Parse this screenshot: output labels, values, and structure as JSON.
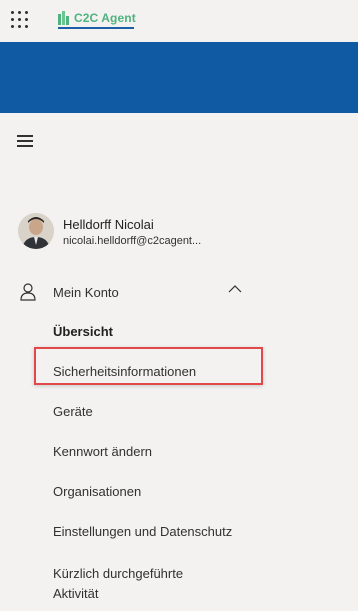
{
  "header": {
    "app_launcher_icon": "waffle-icon",
    "logo_text": "C2C Agent",
    "accent_color": "#4fb37f",
    "banner_color": "#0f5aa3"
  },
  "menu_icon": "hamburger-icon",
  "user": {
    "name": "Helldorff Nicolai",
    "email": "nicolai.helldorff@c2cagent..."
  },
  "nav": {
    "section_label": "Mein Konto",
    "section_icon": "person-icon",
    "section_expanded": true,
    "items": [
      {
        "label": "Übersicht",
        "active": true
      },
      {
        "label": "Sicherheitsinformationen",
        "active": false,
        "highlighted": true
      },
      {
        "label": "Geräte",
        "active": false
      },
      {
        "label": "Kennwort ändern",
        "active": false
      },
      {
        "label": "Organisationen",
        "active": false
      },
      {
        "label": "Einstellungen und Datenschutz",
        "active": false
      },
      {
        "label": "Kürzlich durchgeführte Aktivität",
        "active": false
      }
    ]
  },
  "highlight_color": "#e0484a"
}
